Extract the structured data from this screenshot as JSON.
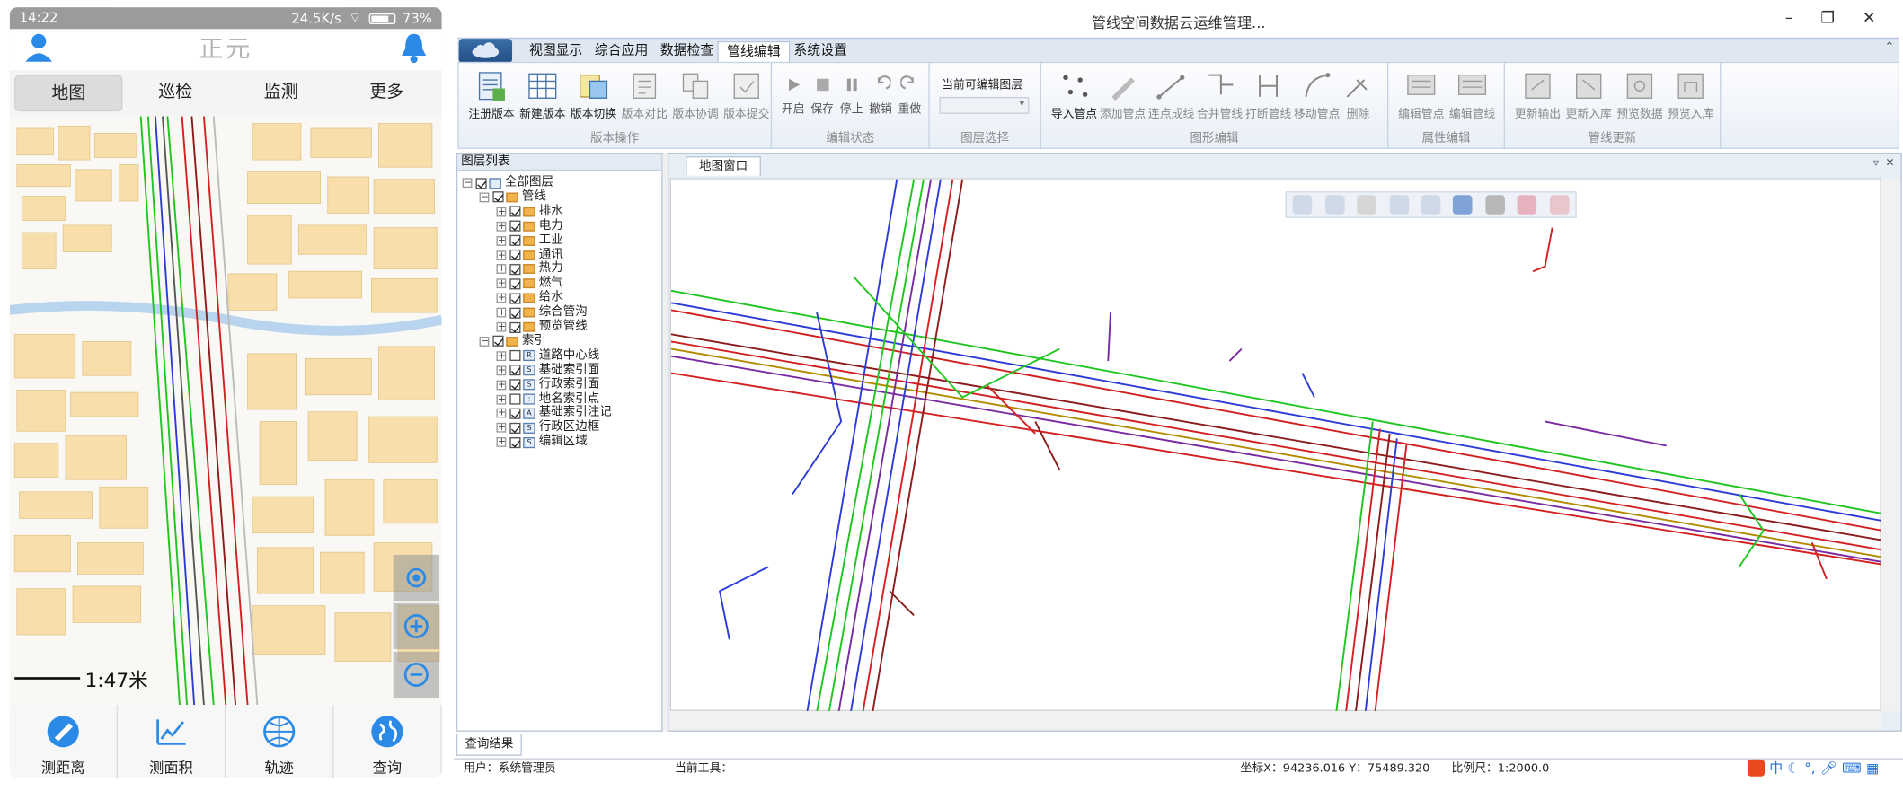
{
  "phone": {
    "status": {
      "time": "14:22",
      "speed": "24.5K/s",
      "battery": "73%"
    },
    "title": "正元",
    "tabs": [
      "地图",
      "巡检",
      "监测",
      "更多"
    ],
    "scale": "1:47米",
    "tools": [
      "测距离",
      "测面积",
      "轨迹",
      "查询"
    ]
  },
  "window": {
    "title": "管线空间数据云运维管理...",
    "ribbon_tabs": [
      "视图显示",
      "综合应用",
      "数据检查",
      "管线编辑",
      "系统设置"
    ],
    "active_tab": "管线编辑",
    "groups": [
      {
        "label": "版本操作",
        "buttons": [
          "注册版本",
          "新建版本",
          "版本切换",
          "版本对比",
          "版本协调",
          "版本提交"
        ]
      },
      {
        "label": "编辑状态",
        "buttons": [
          "开启",
          "保存",
          "停止",
          "撤销",
          "重做"
        ]
      },
      {
        "label": "图层选择",
        "title": "当前可编辑图层"
      },
      {
        "label": "图形编辑",
        "buttons": [
          "导入管点",
          "添加管点",
          "连点成线",
          "合并管线",
          "打断管线",
          "移动管点",
          "删除"
        ]
      },
      {
        "label": "属性编辑",
        "buttons": [
          "编辑管点",
          "编辑管线"
        ]
      },
      {
        "label": "管线更新",
        "buttons": [
          "更新输出",
          "更新入库",
          "预览数据",
          "预览入库"
        ]
      }
    ],
    "layer_panel_title": "图层列表",
    "layers": [
      {
        "name": "全部图层",
        "level": 0,
        "checked": true
      },
      {
        "name": "管线",
        "level": 1,
        "checked": true
      },
      {
        "name": "排水",
        "level": 2,
        "checked": true
      },
      {
        "name": "电力",
        "level": 2,
        "checked": true
      },
      {
        "name": "工业",
        "level": 2,
        "checked": true
      },
      {
        "name": "通讯",
        "level": 2,
        "checked": true
      },
      {
        "name": "热力",
        "level": 2,
        "checked": true
      },
      {
        "name": "燃气",
        "level": 2,
        "checked": true
      },
      {
        "name": "给水",
        "level": 2,
        "checked": true
      },
      {
        "name": "综合管沟",
        "level": 2,
        "checked": true
      },
      {
        "name": "预览管线",
        "level": 2,
        "checked": true
      },
      {
        "name": "索引",
        "level": 1,
        "checked": true
      },
      {
        "name": "道路中心线",
        "level": 2,
        "checked": false
      },
      {
        "name": "基础索引面",
        "level": 2,
        "checked": true
      },
      {
        "name": "行政索引面",
        "level": 2,
        "checked": true
      },
      {
        "name": "地名索引点",
        "level": 2,
        "checked": false
      },
      {
        "name": "基础索引注记",
        "level": 2,
        "checked": true
      },
      {
        "name": "行政区边框",
        "level": 2,
        "checked": true
      },
      {
        "name": "编辑区域",
        "level": 2,
        "checked": true
      }
    ],
    "map_tab": "地图窗口",
    "bottom_tab": "查询结果",
    "status": {
      "user": "用户：系统管理员",
      "tool": "当前工具：",
      "coords": "坐标X：94236.016  Y：75489.320",
      "scale": "比例尺：1:2000.0"
    },
    "tray": {
      "ime": "中"
    }
  }
}
